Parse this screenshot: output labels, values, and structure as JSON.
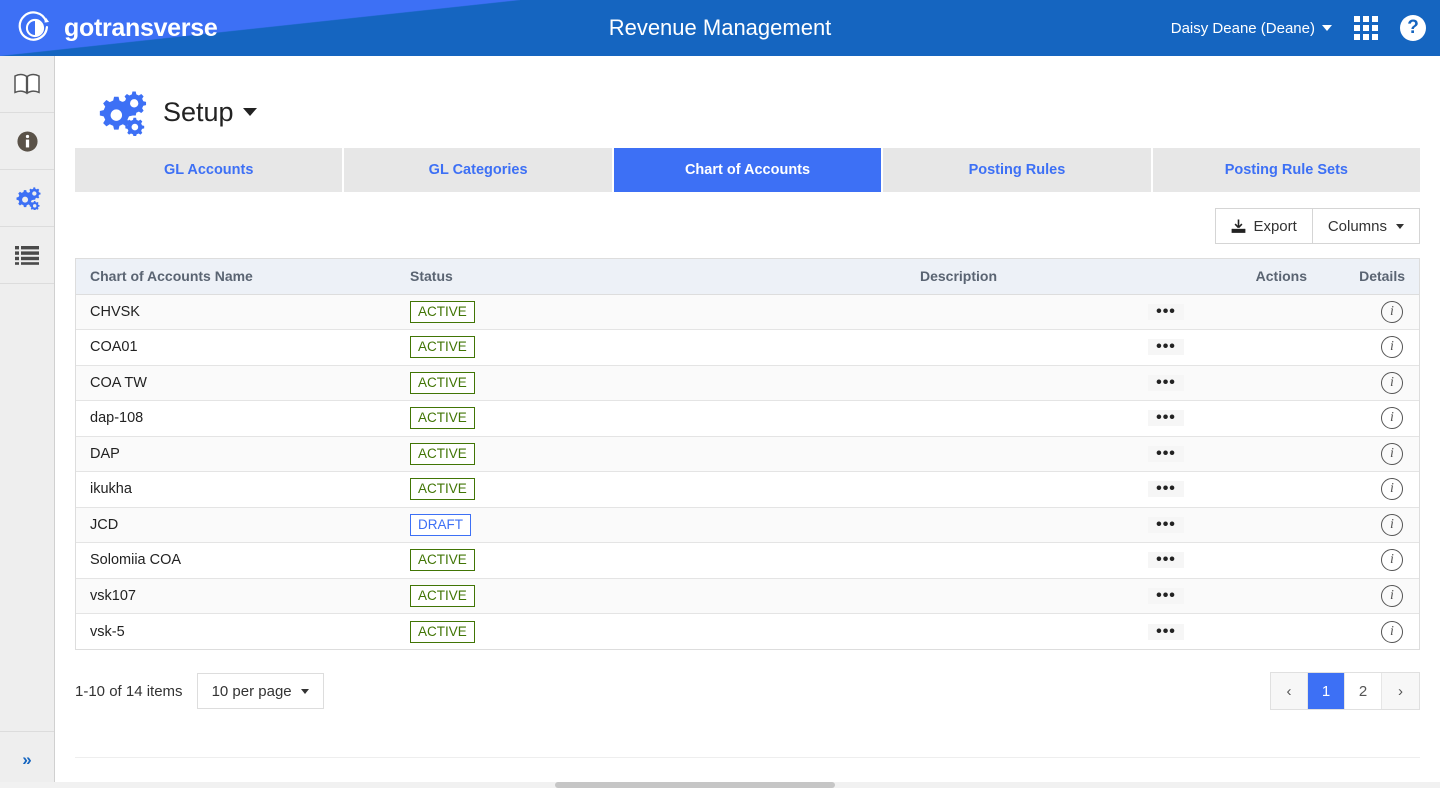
{
  "topbar": {
    "brand_name": "gotransverse",
    "brand_logo_icon": "gotransverse-circle-logo",
    "app_title": "Revenue Management",
    "user_name": "Daisy Deane (Deane)",
    "user_caret_icon": "caret-down-icon",
    "apps_grid_icon": "apps-grid-icon",
    "help_icon": "help-question-icon",
    "help_glyph": "?"
  },
  "rail": {
    "items": [
      {
        "name": "book-icon",
        "glyph": "📖"
      },
      {
        "name": "info-icon",
        "glyph": "ℹ"
      },
      {
        "name": "gears-icon",
        "glyph": "⚙"
      },
      {
        "name": "list-icon",
        "glyph": "☰"
      }
    ],
    "expand_glyph": "»",
    "expand_name": "expand-sidebar-button"
  },
  "page": {
    "title": "Setup",
    "title_icon": "gears-icon",
    "title_caret_icon": "caret-down-icon"
  },
  "tabs": [
    {
      "label": "GL Accounts",
      "active": false
    },
    {
      "label": "GL Categories",
      "active": false
    },
    {
      "label": "Chart of Accounts",
      "active": true
    },
    {
      "label": "Posting Rules",
      "active": false
    },
    {
      "label": "Posting Rule Sets",
      "active": false
    }
  ],
  "toolbar": {
    "export_label": "Export",
    "export_icon": "download-icon",
    "columns_label": "Columns",
    "columns_caret_icon": "caret-down-icon"
  },
  "table": {
    "columns": [
      "Chart of Accounts Name",
      "Status",
      "Description",
      "Actions",
      "Details"
    ],
    "rows": [
      {
        "name": "CHVSK",
        "status": "ACTIVE",
        "status_kind": "active",
        "description": ""
      },
      {
        "name": "COA01",
        "status": "ACTIVE",
        "status_kind": "active",
        "description": ""
      },
      {
        "name": "COA TW",
        "status": "ACTIVE",
        "status_kind": "active",
        "description": ""
      },
      {
        "name": "dap-108",
        "status": "ACTIVE",
        "status_kind": "active",
        "description": ""
      },
      {
        "name": "DAP",
        "status": "ACTIVE",
        "status_kind": "active",
        "description": ""
      },
      {
        "name": "ikukha",
        "status": "ACTIVE",
        "status_kind": "active",
        "description": ""
      },
      {
        "name": "JCD",
        "status": "DRAFT",
        "status_kind": "draft",
        "description": ""
      },
      {
        "name": "Solomiia COA",
        "status": "ACTIVE",
        "status_kind": "active",
        "description": ""
      },
      {
        "name": "vsk107",
        "status": "ACTIVE",
        "status_kind": "active",
        "description": ""
      },
      {
        "name": "vsk-5",
        "status": "ACTIVE",
        "status_kind": "active",
        "description": ""
      }
    ],
    "action_glyph": "•••",
    "details_glyph": "i"
  },
  "footer": {
    "items_count": "1-10 of 14 items",
    "per_page_label": "10 per page",
    "per_page_caret_icon": "caret-down-icon",
    "pager": {
      "prev_glyph": "‹",
      "next_glyph": "›",
      "pages": [
        "1",
        "2"
      ],
      "active_page": "1"
    }
  },
  "colors": {
    "brand_blue": "#3d70f5",
    "header_blue": "#1565c0",
    "active_green": "#417505",
    "draft_blue": "#3d70f5"
  }
}
